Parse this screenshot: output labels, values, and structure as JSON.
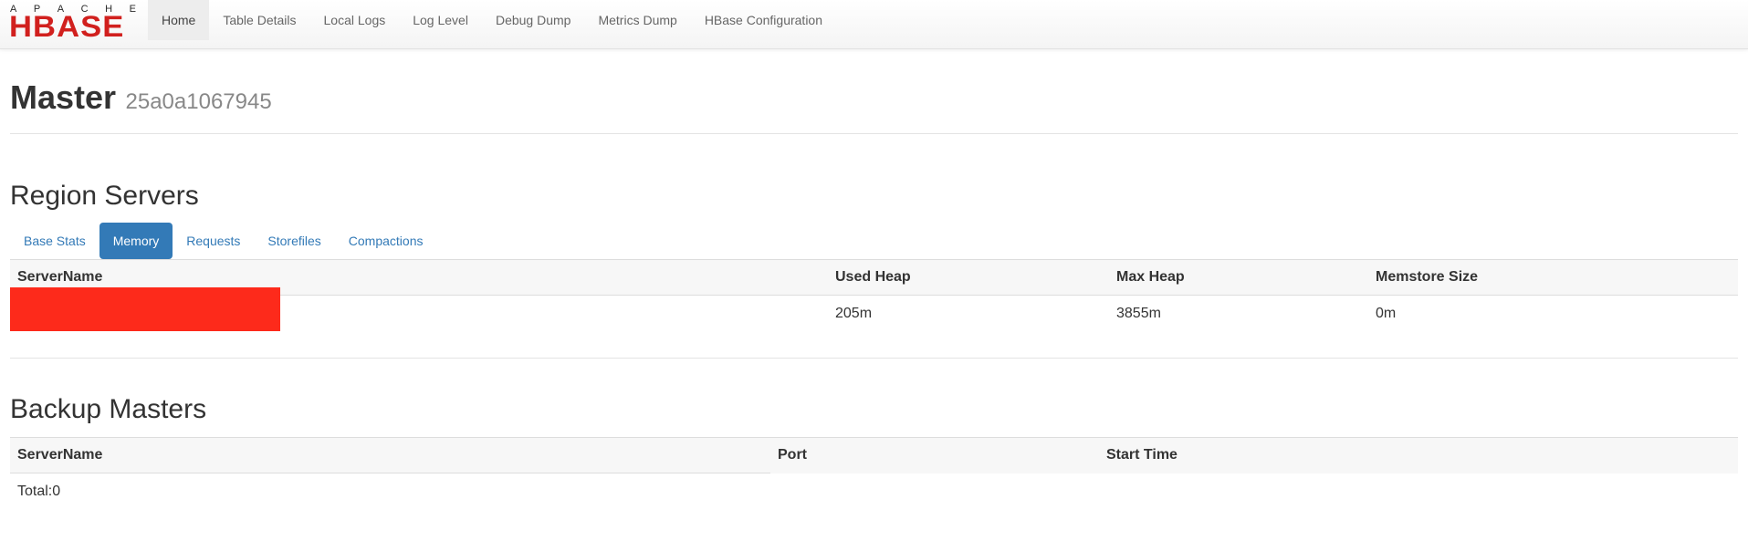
{
  "brand": {
    "top": [
      "A",
      "P",
      "A",
      "C",
      "H",
      "E"
    ],
    "main": "HBASE"
  },
  "nav": [
    {
      "label": "Home",
      "active": true
    },
    {
      "label": "Table Details"
    },
    {
      "label": "Local Logs"
    },
    {
      "label": "Log Level"
    },
    {
      "label": "Debug Dump"
    },
    {
      "label": "Metrics Dump"
    },
    {
      "label": "HBase Configuration"
    }
  ],
  "header": {
    "title": "Master",
    "host": "25a0a1067945"
  },
  "region_servers": {
    "heading": "Region Servers",
    "tabs": [
      {
        "label": "Base Stats"
      },
      {
        "label": "Memory",
        "active": true
      },
      {
        "label": "Requests"
      },
      {
        "label": "Storefiles"
      },
      {
        "label": "Compactions"
      }
    ],
    "columns": [
      "ServerName",
      "Used Heap",
      "Max Heap",
      "Memstore Size"
    ],
    "rows": [
      {
        "server": "",
        "used_heap": "205m",
        "max_heap": "3855m",
        "memstore": "0m"
      }
    ]
  },
  "backup_masters": {
    "heading": "Backup Masters",
    "columns": [
      "ServerName",
      "Port",
      "Start Time"
    ],
    "total": "Total:0"
  },
  "colors": {
    "accent": "#337ab7",
    "brand": "#d1201e",
    "redaction": "#fd2a1b"
  }
}
